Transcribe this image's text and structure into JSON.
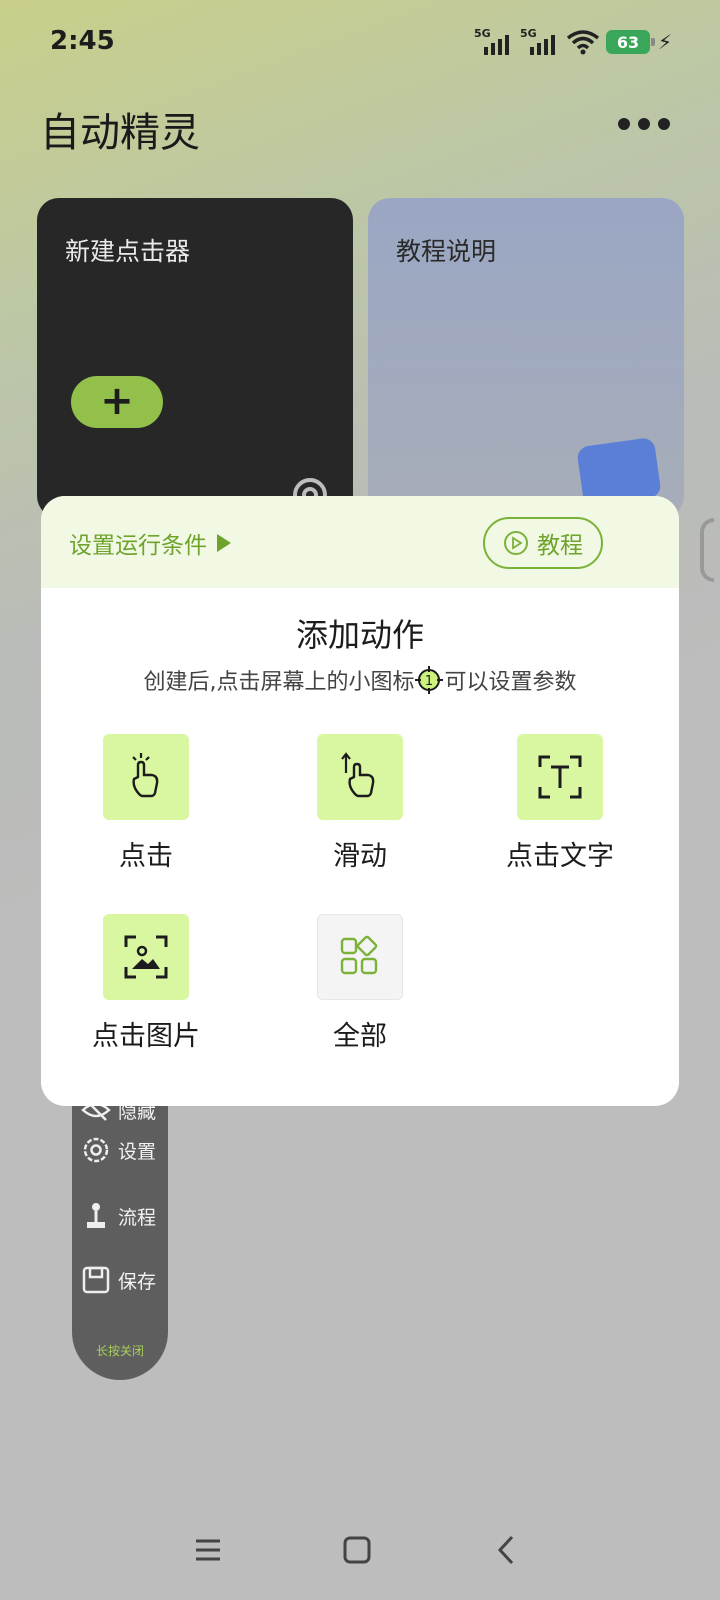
{
  "status_bar": {
    "time": "2:45",
    "signal_labels": [
      "5G",
      "5G"
    ],
    "battery_level": "63"
  },
  "app": {
    "title": "自动精灵",
    "cards": {
      "new_clicker": "新建点击器",
      "tutorial": "教程说明"
    }
  },
  "floating_toolbar": {
    "items": [
      {
        "label": "隐藏",
        "icon": "eye-off-icon"
      },
      {
        "label": "设置",
        "icon": "gear-icon"
      },
      {
        "label": "流程",
        "icon": "flow-icon"
      },
      {
        "label": "保存",
        "icon": "save-icon"
      }
    ],
    "hint": "长按关闭"
  },
  "modal": {
    "condition_link": "设置运行条件",
    "tutorial_button": "教程",
    "title": "添加动作",
    "subtitle_before": "创建后,点击屏幕上的小图标",
    "subtitle_after": "可以设置参数",
    "actions": [
      {
        "label": "点击",
        "icon": "tap-icon"
      },
      {
        "label": "滑动",
        "icon": "swipe-icon"
      },
      {
        "label": "点击文字",
        "icon": "text-scan-icon"
      },
      {
        "label": "点击图片",
        "icon": "image-scan-icon"
      },
      {
        "label": "全部",
        "icon": "grid-icon"
      }
    ]
  },
  "colors": {
    "accent_green": "#6ea32c",
    "tile_green": "#d9f7a0",
    "modal_head": "#f1f8e4"
  }
}
